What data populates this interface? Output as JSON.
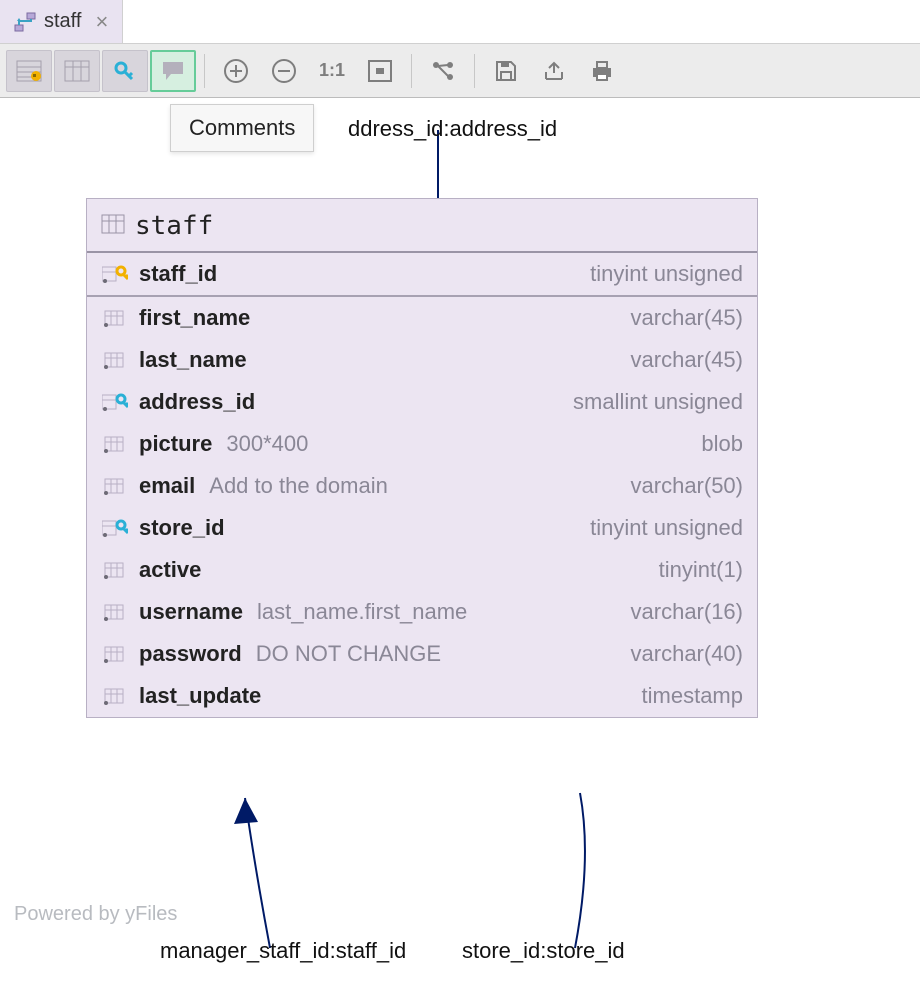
{
  "tab": {
    "label": "staff"
  },
  "tooltip": {
    "label": "Comments"
  },
  "edges": {
    "top": "ddress_id:address_id",
    "bottom_left": "manager_staff_id:staff_id",
    "bottom_right": "store_id:store_id"
  },
  "table": {
    "name": "staff",
    "columns": [
      {
        "key": "pk",
        "name": "staff_id",
        "type": "tinyint unsigned",
        "comment": "",
        "pk": true,
        "fk": false
      },
      {
        "key": "c1",
        "name": "first_name",
        "type": "varchar(45)",
        "comment": "",
        "pk": false,
        "fk": false
      },
      {
        "key": "c2",
        "name": "last_name",
        "type": "varchar(45)",
        "comment": "",
        "pk": false,
        "fk": false
      },
      {
        "key": "c3",
        "name": "address_id",
        "type": "smallint unsigned",
        "comment": "",
        "pk": false,
        "fk": true
      },
      {
        "key": "c4",
        "name": "picture",
        "type": "blob",
        "comment": "300*400",
        "pk": false,
        "fk": false
      },
      {
        "key": "c5",
        "name": "email",
        "type": "varchar(50)",
        "comment": "Add to the domain",
        "pk": false,
        "fk": false
      },
      {
        "key": "c6",
        "name": "store_id",
        "type": "tinyint unsigned",
        "comment": "",
        "pk": false,
        "fk": true
      },
      {
        "key": "c7",
        "name": "active",
        "type": "tinyint(1)",
        "comment": "",
        "pk": false,
        "fk": false
      },
      {
        "key": "c8",
        "name": "username",
        "type": "varchar(16)",
        "comment": "last_name.first_name",
        "pk": false,
        "fk": false
      },
      {
        "key": "c9",
        "name": "password",
        "type": "varchar(40)",
        "comment": "DO NOT CHANGE",
        "pk": false,
        "fk": false
      },
      {
        "key": "c10",
        "name": "last_update",
        "type": "timestamp",
        "comment": "",
        "pk": false,
        "fk": false
      }
    ]
  },
  "watermark": "Powered by yFiles"
}
